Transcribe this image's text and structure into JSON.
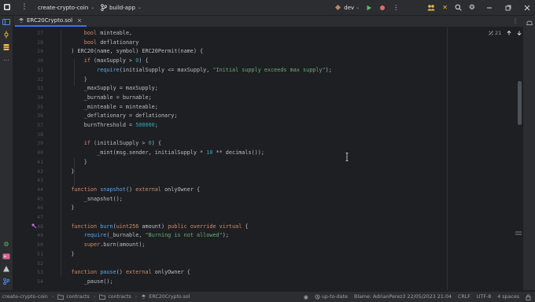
{
  "titlebar": {
    "project": "create-crypto-coin",
    "branch": "build-app",
    "run_config": "dev"
  },
  "editor": {
    "tab_label": "ERC20Crypto.sol",
    "inspection_count": "21",
    "lines": [
      {
        "n": "27",
        "code": [
          {
            "t": "        "
          },
          {
            "t": "bool",
            "c": "type"
          },
          {
            "t": " minteable,"
          }
        ]
      },
      {
        "n": "28",
        "code": [
          {
            "t": "        "
          },
          {
            "t": "bool",
            "c": "type"
          },
          {
            "t": " deflationary"
          }
        ]
      },
      {
        "n": "29",
        "code": [
          {
            "t": "    ) ERC20(name, symbol) ERC20Permit(name) {"
          }
        ]
      },
      {
        "n": "30",
        "code": [
          {
            "t": "        "
          },
          {
            "t": "if",
            "c": "kw"
          },
          {
            "t": " (maxSupply > "
          },
          {
            "t": "0",
            "c": "num"
          },
          {
            "t": ") {"
          }
        ]
      },
      {
        "n": "31",
        "code": [
          {
            "t": "            "
          },
          {
            "t": "require",
            "c": "fn"
          },
          {
            "t": "(initialSupply <= maxSupply, "
          },
          {
            "t": "\"Initial supply exceeds max supply\"",
            "c": "str"
          },
          {
            "t": ");"
          }
        ]
      },
      {
        "n": "32",
        "code": [
          {
            "t": "        }"
          }
        ]
      },
      {
        "n": "33",
        "code": [
          {
            "t": "        _maxSupply = maxSupply;"
          }
        ]
      },
      {
        "n": "34",
        "code": [
          {
            "t": "        _burnable = burnable;"
          }
        ]
      },
      {
        "n": "35",
        "code": [
          {
            "t": "        _minteable = minteable;"
          }
        ]
      },
      {
        "n": "36",
        "code": [
          {
            "t": "        _deflationary = deflationary;"
          }
        ]
      },
      {
        "n": "37",
        "code": [
          {
            "t": "        burnThreshold = "
          },
          {
            "t": "500000",
            "c": "num"
          },
          {
            "t": ";"
          }
        ]
      },
      {
        "n": "38",
        "code": []
      },
      {
        "n": "39",
        "code": [
          {
            "t": "        "
          },
          {
            "t": "if",
            "c": "kw"
          },
          {
            "t": " (initialSupply > "
          },
          {
            "t": "0",
            "c": "num"
          },
          {
            "t": ") {"
          }
        ]
      },
      {
        "n": "40",
        "code": [
          {
            "t": "            _mint(msg.sender, initialSupply * "
          },
          {
            "t": "10",
            "c": "num"
          },
          {
            "t": " ** decimals());"
          }
        ]
      },
      {
        "n": "41",
        "code": [
          {
            "t": "        }"
          }
        ]
      },
      {
        "n": "42",
        "code": [
          {
            "t": "    }"
          }
        ]
      },
      {
        "n": "43",
        "code": []
      },
      {
        "n": "44",
        "code": [
          {
            "t": "    "
          },
          {
            "t": "function",
            "c": "kw"
          },
          {
            "t": " "
          },
          {
            "t": "snapshot",
            "c": "fn"
          },
          {
            "t": "() "
          },
          {
            "t": "external",
            "c": "kw"
          },
          {
            "t": " onlyOwner {"
          }
        ]
      },
      {
        "n": "45",
        "code": [
          {
            "t": "        _snapshot();"
          }
        ]
      },
      {
        "n": "46",
        "code": [
          {
            "t": "    }"
          }
        ]
      },
      {
        "n": "47",
        "code": []
      },
      {
        "n": "48",
        "code": [
          {
            "t": "    "
          },
          {
            "t": "function",
            "c": "kw"
          },
          {
            "t": " "
          },
          {
            "t": "burn",
            "c": "fn"
          },
          {
            "t": "("
          },
          {
            "t": "uint256",
            "c": "type"
          },
          {
            "t": " amount) "
          },
          {
            "t": "public override virtual",
            "c": "kw"
          },
          {
            "t": " {"
          }
        ]
      },
      {
        "n": "49",
        "code": [
          {
            "t": "        "
          },
          {
            "t": "require",
            "c": "fn"
          },
          {
            "t": "(_burnable, "
          },
          {
            "t": "\"Burning is not allowed\"",
            "c": "str"
          },
          {
            "t": ");"
          }
        ]
      },
      {
        "n": "50",
        "code": [
          {
            "t": "        "
          },
          {
            "t": "super",
            "c": "kw"
          },
          {
            "t": ".burn(amount);"
          }
        ]
      },
      {
        "n": "51",
        "code": [
          {
            "t": "    }"
          }
        ]
      },
      {
        "n": "52",
        "code": []
      },
      {
        "n": "53",
        "code": [
          {
            "t": "    "
          },
          {
            "t": "function",
            "c": "kw"
          },
          {
            "t": " "
          },
          {
            "t": "pause",
            "c": "fn"
          },
          {
            "t": "() "
          },
          {
            "t": "external",
            "c": "kw"
          },
          {
            "t": " onlyOwner {"
          }
        ]
      },
      {
        "n": "54",
        "code": [
          {
            "t": "        _pause();"
          }
        ]
      }
    ]
  },
  "statusbar": {
    "breadcrumbs": [
      "create-crypto-coin",
      "contracts",
      "contracts",
      "ERC20Crypto.sol"
    ],
    "vcs": "up-to-date",
    "blame": "Blame: AdrianPerez3 22/05/2023 21:04",
    "line_sep": "CRLF",
    "encoding": "UTF-8",
    "indent": "4 spaces"
  },
  "colors": {
    "accent": "#3574f0",
    "run_green": "#5fb865",
    "debug_red": "#e06c6c"
  }
}
